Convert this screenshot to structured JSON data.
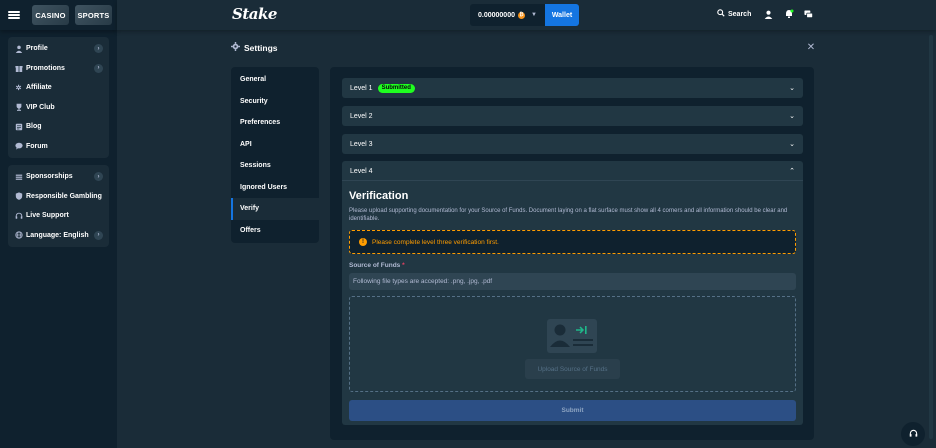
{
  "header": {
    "modes": [
      "CASINO",
      "SPORTS"
    ],
    "logo": "Stake",
    "balance": "0.00000000",
    "coin_icon": "bitcoin-icon",
    "wallet_label": "Wallet",
    "search_label": "Search"
  },
  "sidebar": {
    "group1": [
      {
        "label": "Profile",
        "icon": "user-icon",
        "has_chevron": true
      },
      {
        "label": "Promotions",
        "icon": "gift-icon",
        "has_chevron": true
      },
      {
        "label": "Affiliate",
        "icon": "affiliate-icon",
        "has_chevron": false
      },
      {
        "label": "VIP Club",
        "icon": "trophy-icon",
        "has_chevron": false
      },
      {
        "label": "Blog",
        "icon": "blog-icon",
        "has_chevron": false
      },
      {
        "label": "Forum",
        "icon": "forum-icon",
        "has_chevron": false
      }
    ],
    "group2": [
      {
        "label": "Sponsorships",
        "icon": "sponsorship-icon",
        "has_chevron": true
      },
      {
        "label": "Responsible Gambling",
        "icon": "shield-icon",
        "has_chevron": false
      },
      {
        "label": "Live Support",
        "icon": "headset-icon",
        "has_chevron": false
      },
      {
        "label": "Language: English",
        "icon": "globe-icon",
        "has_chevron": true
      }
    ]
  },
  "settings": {
    "title": "Settings",
    "nav": [
      "General",
      "Security",
      "Preferences",
      "API",
      "Sessions",
      "Ignored Users",
      "Verify",
      "Offers"
    ],
    "active_nav": "Verify",
    "levels": [
      {
        "label": "Level 1",
        "badge": "Submitted"
      },
      {
        "label": "Level 2"
      },
      {
        "label": "Level 3"
      },
      {
        "label": "Level 4"
      }
    ],
    "verification": {
      "title": "Verification",
      "description": "Please upload supporting documentation for your Source of Funds. Document laying on a flat surface must show all 4 corners and all information should be clear and identifiable.",
      "warning": "Please complete level three verification first.",
      "source_label": "Source of Funds",
      "required_mark": "*",
      "file_types": "Following file types are accepted: .png, .jpg, .pdf",
      "upload_label": "Upload Source of Funds",
      "submit_label": "Submit"
    }
  },
  "colors": {
    "bg": "#1a2c38",
    "panel": "#0f212e",
    "accent": "#1475e1",
    "success": "#1fff20",
    "warning": "#ff9d00"
  }
}
